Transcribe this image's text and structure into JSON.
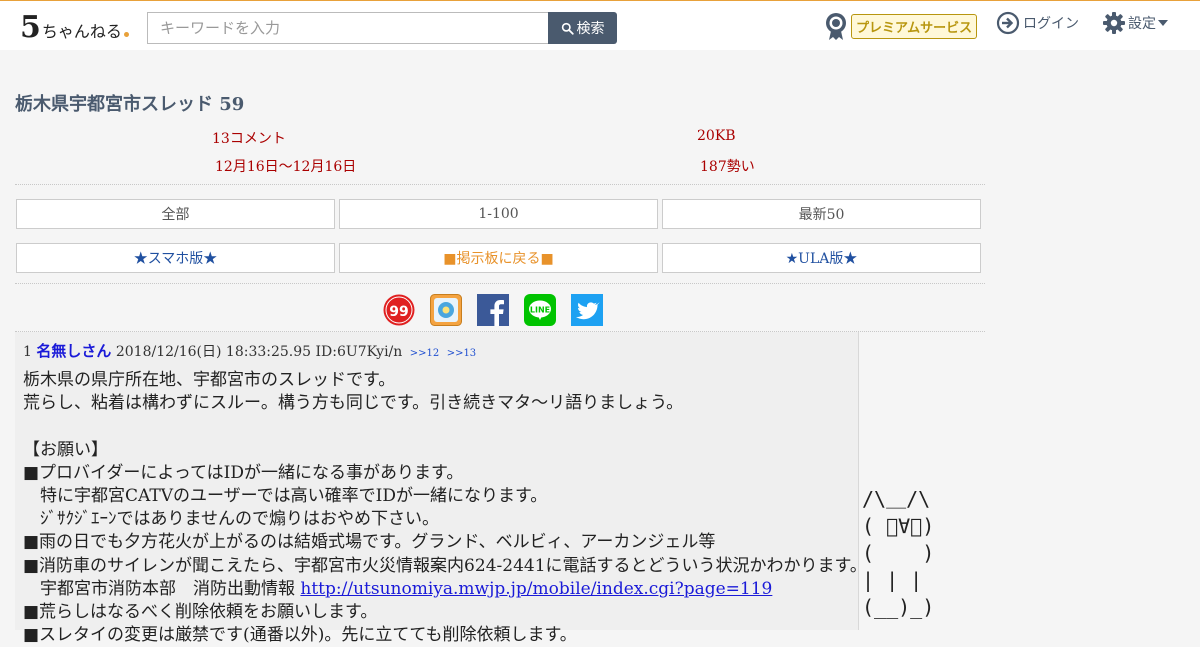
{
  "header": {
    "logo_five": "5",
    "logo_rest": "ちゃんねる",
    "search_placeholder": "キーワードを入力",
    "search_button": "検索",
    "premium_label": "プレミアムサービス",
    "login_label": "ログイン",
    "settings_label": "設定"
  },
  "thread": {
    "title": "栃木県宇都宮市スレッド 59",
    "comments": "13コメント",
    "size": "20KB",
    "date_range": "12月16日〜12月16日",
    "momentum": "187勢い"
  },
  "nav": {
    "all": "全部",
    "range": "1-100",
    "latest": "最新50",
    "smartphone": "★スマホ版★",
    "back_to_board": "■掲示板に戻る■",
    "ula": "★ULA版★"
  },
  "share": [
    "99-icon",
    "photo-icon",
    "facebook-icon",
    "line-icon",
    "twitter-icon"
  ],
  "post": {
    "number": "1",
    "name": "名無しさん",
    "datetime": "2018/12/16(日) 18:33:25.95",
    "id": "ID:6U7Kyi/n",
    "reply_1": ">>12",
    "reply_2": ">>13",
    "line1": "栃木県の県庁所在地、宇都宮市のスレッドです。",
    "line2": "荒らし、粘着は構わずにスルー。構う方も同じです。引き続きマタ～リ語りましょう。",
    "line3": "",
    "line4": "【お願い】",
    "line5": "■プロバイダーによってはIDが一緒になる事があります。",
    "line6": "　特に宇都宮CATVのユーザーでは高い確率でIDが一緒になります。",
    "line7": "　ｼﾞｻｸｼﾞｴｰﾝではありませんので煽りはおやめ下さい。",
    "line8": "■雨の日でも夕方花火が上がるのは結婚式場です。グランド、ベルビィ、アーカンジェル等",
    "line9": "■消防車のサイレンが聞こえたら、宇都宮市火災情報案内624-2441に電話するとどういう状況かわかります。",
    "line10_prefix": "　宇都宮市消防本部　消防出動情報 ",
    "line10_link": "http://utsunomiya.mwjp.jp/mobile/index.cgi?page=119",
    "line11": "■荒らしはなるべく削除依頼をお願いします。",
    "line12": "■スレタイの変更は厳禁です(通番以外)。先に立てても削除依頼します。"
  },
  "ascii_art": "/\\＿/\\\n( ﾟ∀ﾟ)\n(    )\n| | |\n(__)_)"
}
